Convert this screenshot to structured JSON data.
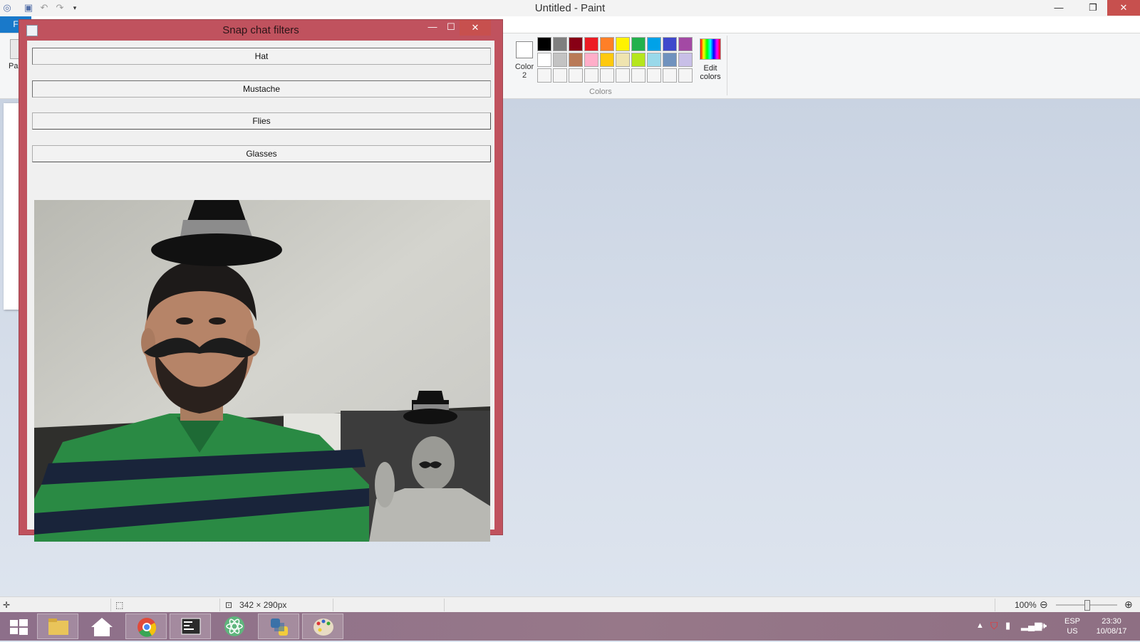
{
  "paint": {
    "title": "Untitled - Paint",
    "file_tab": "F",
    "paste_label": "Pa",
    "color2_label_line1": "Color",
    "color2_label_line2": "2",
    "edit_colors_line1": "Edit",
    "edit_colors_line2": "colors",
    "colors_group_label": "Colors",
    "palette": [
      "#000000",
      "#7f7f7f",
      "#880015",
      "#ed1c24",
      "#ff7f27",
      "#fff200",
      "#22b14c",
      "#00a2e8",
      "#3f48cc",
      "#a349a4",
      "#ffffff",
      "#c3c3c3",
      "#b97a57",
      "#ffaec9",
      "#ffc90e",
      "#efe4b0",
      "#b5e61d",
      "#99d9ea",
      "#7092be",
      "#c8bfe7",
      "#f5f5f5",
      "#f5f5f5",
      "#f5f5f5",
      "#f5f5f5",
      "#f5f5f5",
      "#f5f5f5",
      "#f5f5f5",
      "#f5f5f5",
      "#f5f5f5",
      "#f5f5f5"
    ],
    "status": {
      "image_size": "342 × 290px",
      "zoom": "100%"
    }
  },
  "dialog": {
    "title": "Snap chat filters",
    "buttons": {
      "hat": "Hat",
      "mustache": "Mustache",
      "flies": "Flies",
      "glasses": "Glasses"
    }
  },
  "taskbar": {
    "language_line1": "ESP",
    "language_line2": "US",
    "time": "23:30",
    "date": "10/08/17"
  }
}
